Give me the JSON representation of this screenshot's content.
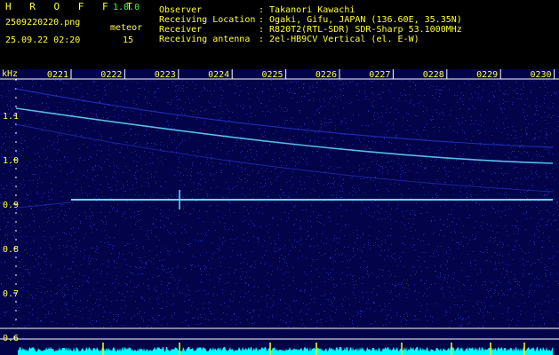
{
  "header": {
    "app_title": "H R O F F T",
    "version": "1.0.0",
    "filename": "2509220220.png",
    "datetime": "25.09.22 02:20",
    "meteor_label": "meteor",
    "meteor_count": "15",
    "info": [
      {
        "label": "Observer",
        "value": ": Takanori Kawachi"
      },
      {
        "label": "Receiving Location",
        "value": ": Ogaki, Gifu, JAPAN (136.60E, 35.35N)"
      },
      {
        "label": "Receiver",
        "value": ": R820T2(RTL-SDR) SDR-Sharp 53.1000MHz"
      },
      {
        "label": "Receiving antenna",
        "value": ": 2el-HB9CV Vertical (el. E-W)"
      }
    ]
  },
  "spectrogram": {
    "unit_label": "kHz",
    "time_ticks": [
      "0221",
      "0222",
      "0223",
      "0224",
      "0225",
      "0226",
      "0227",
      "0228",
      "0229",
      "0230"
    ],
    "freq_ticks": [
      "1.1",
      "1.0",
      "0.9",
      "0.8",
      "0.7",
      "0.6"
    ],
    "colors": {
      "background": "#03034a",
      "noise": "#2a3ad0",
      "signal": "#66ddff",
      "tick": "#ffffff",
      "label": "#ffff33",
      "meteor": "#ffff00",
      "level": "#00ffff"
    }
  }
}
